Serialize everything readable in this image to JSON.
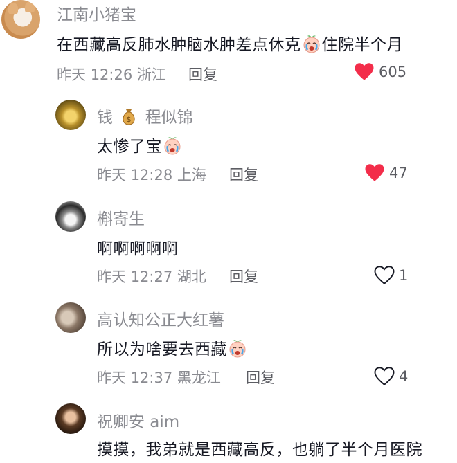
{
  "comments": [
    {
      "username": "江南小猪宝",
      "text_before": "在西藏高反肺水肿脑水肿差点休克",
      "text_after": "住院半个月",
      "emoji": "crying-face-icon",
      "date": "昨天",
      "time": "12:26",
      "location": "浙江",
      "reply_label": "回复",
      "likes": "605",
      "liked": true
    },
    {
      "username_prefix": "钱",
      "username_suffix": "程似锦",
      "text_before": "太惨了宝",
      "emoji": "crying-face-icon",
      "date": "昨天",
      "time": "12:28",
      "location": "上海",
      "reply_label": "回复",
      "likes": "47",
      "liked": true
    },
    {
      "username": "槲寄生",
      "text_before": "啊啊啊啊啊",
      "date": "昨天",
      "time": "12:27",
      "location": "湖北",
      "reply_label": "回复",
      "likes": "1",
      "liked": false
    },
    {
      "username": "高认知公正大红薯",
      "text_before": "所以为啥要去西藏",
      "emoji": "crying-face-icon",
      "date": "昨天",
      "time": "12:37",
      "location": "黑龙江",
      "reply_label": "回复",
      "likes": "4",
      "liked": false
    },
    {
      "username": "祝卿安 aim",
      "text_before": "摸摸，我弟就是西藏高反，也躺了半个月医院"
    }
  ],
  "colors": {
    "like_red": "#f32d4a",
    "meta_gray": "#8a8b91",
    "text": "#161823"
  }
}
